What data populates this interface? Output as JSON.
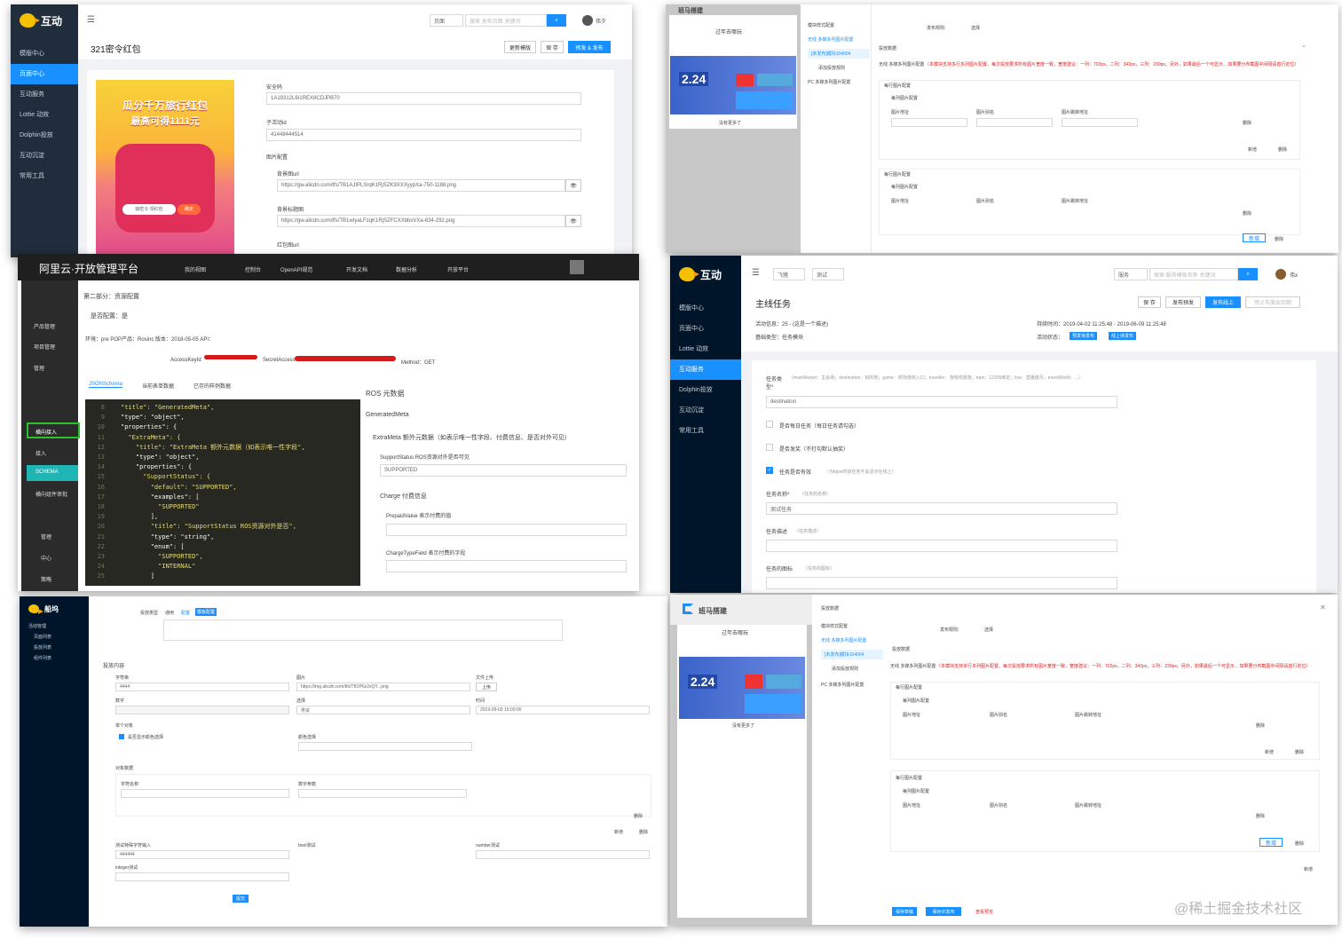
{
  "colors": {
    "primary": "#1890ff",
    "sidebar": "#1f2d3d",
    "aliyun_bar": "#1f1f1f",
    "code_bg": "#272822",
    "highlight_green": "#2ac12a"
  },
  "p1": {
    "brand": "互动",
    "nav": [
      "模版中心",
      "页面中心",
      "互动服务",
      "Lottie 动效",
      "Dolphin投放",
      "互动沉淀",
      "常用工具"
    ],
    "search_select": "页面",
    "search_placeholder": "搜索 发布页面 关键词",
    "user": "伟夕",
    "title": "321密令红包",
    "btn_update": "更新模版",
    "btn_save": "保 存",
    "btn_publish": "预发 & 发布",
    "poster": {
      "top": "瓜分千万旅行红包",
      "mid": "最高可得1111元",
      "sub": "输密令 领红包",
      "sub2": "确定"
    },
    "f_key_label": "安全码",
    "f_key_value": "1A19312L6I1REX8CDJPB70",
    "f_id_label": "子活动id",
    "f_id_value": "41448444514",
    "f_img_label": "图片配置",
    "f_bg_label": "背景图url",
    "f_bg_value": "https://gw.alicdn.com/tfs/TB1AJIPLSrqK1RjSZK9XXXyypXa-750-1188.png",
    "f_title_label": "背景标题图",
    "f_title_value": "https://gw.alicdn.com/tfs/TB1wIyaLFzqK1RjSZFCXXbbvVXa-634-292.png",
    "f_packet_label": "红包图url"
  },
  "p2": {
    "title": "班马搭建",
    "banner": "过年去哪玩",
    "more": "没有更多了",
    "date": "2.24",
    "tree": [
      "模块样式配置",
      "无线 多媒多列图片配置",
      "[未发布]模块104004",
      "添加投放规则",
      "PC 多媒多列图片配置"
    ],
    "rules_label": "发布规则:",
    "rules_val": "选择",
    "put": "投放数据",
    "wireless": "无线 多媒多列图片配置",
    "note": "（本模块支持多行多列图片配置。每次投放要求所有图片宽度一致，宽度建议：一列：702px，二列：342px，三列：230px。另外，如果最后一个可显示... 如果要分布截图中间隔请首行定位）",
    "row_cfg": "每行图片配置",
    "col_cfg": "每列图片配置",
    "c1": "图片地址",
    "c2": "图片别名",
    "c3": "图片跳转地址",
    "del": "删除",
    "add": "新增"
  },
  "p3": {
    "brand": "阿里云·开放管理平台",
    "top_nav": [
      "我的视图",
      "控制台",
      "OpenAPI规范",
      "开发文档",
      "数据分析",
      "开放平台"
    ],
    "section": "第二部分：资源配置",
    "sub": "是否配置：是",
    "env": "环境：pre  POP产品：Rosinc  版本：2018-05-05  API：",
    "keyid": "AccessKeyId",
    "secret": "SecretAccess",
    "method": "Method：GET",
    "tabs": [
      "JSONSchema",
      "当前表单数据",
      "已存的样例数据"
    ],
    "side": [
      "产品管理",
      "项目管理",
      "管理",
      "",
      "",
      "横向接入",
      "接入",
      "SCHEMA",
      "横向组件审批",
      "",
      "管理",
      "中心",
      "策略"
    ],
    "lines": [
      [
        "8",
        "\"title\": \"GeneratedMeta\","
      ],
      [
        "9",
        "\"type\": \"object\","
      ],
      [
        "10",
        "\"properties\": {"
      ],
      [
        "11",
        "  \"ExtraMeta\": {"
      ],
      [
        "12",
        "    \"title\": \"ExtraMeta 额外元数据（如表示唯一性字段\","
      ],
      [
        "13",
        "    \"type\": \"object\","
      ],
      [
        "14",
        "    \"properties\": {"
      ],
      [
        "15",
        "      \"SupportStatus\": {"
      ],
      [
        "16",
        "        \"default\": \"SUPPORTED\","
      ],
      [
        "17",
        "        \"examples\": ["
      ],
      [
        "18",
        "          \"SUPPORTED\""
      ],
      [
        "19",
        "        ],"
      ],
      [
        "20",
        "        \"title\": \"SupportStatus ROS资源对外是否\","
      ],
      [
        "21",
        "        \"type\": \"string\","
      ],
      [
        "22",
        "        \"enum\": ["
      ],
      [
        "23",
        "          \"SUPPORTED\","
      ],
      [
        "24",
        "          \"INTERNAL\""
      ],
      [
        "25",
        "        ]"
      ]
    ],
    "ros": "ROS 元数据",
    "gen": "GeneratedMeta",
    "extra": "ExtraMeta 额外元数据（如表示唯一性字段、付费信息、是否对外可见）",
    "support_label": "SupportStatus ROS资源对外是否可见",
    "support_val": "SUPPORTED",
    "charge": "Charge 付费信息",
    "prepaid": "PrepaidValue 表示付费的值",
    "chargetype": "ChargeTypeField 表示付费的字段"
  },
  "p4": {
    "brand": "互动",
    "nav": [
      "模版中心",
      "页面中心",
      "Lottie 动效",
      "互动服务",
      "Dolphin投放",
      "互动沉淀",
      "常用工具"
    ],
    "sel1": "飞猪",
    "sel2": "测试",
    "sel3": "服务",
    "search_placeholder": "搜索 服务模板名称 关键词",
    "user": "伟x",
    "title": "主线任务",
    "b_save": "保 存",
    "b_pre": "发布预发",
    "b_online": "发布线上",
    "b_stop": "停止灰度出到期",
    "info1": "活动信息：25 - (这是一个描述)",
    "info2": "基础类型：任务模块",
    "time": "持续时间：2019-04-02 11:25:48 - 2019-06-09 11:25:48",
    "status_label": "活动状态：",
    "tag1": "预发待发布",
    "tag2": "线上待发布",
    "task_type": "任务类型*",
    "task_hint": "（mainMarket：主会场；destination：目的地；game：商场游戏入口；traveller：游戏线旅游；train：12306绑定；live：直播首页；travelWorld：...）",
    "task_val": "destination",
    "c1": "是否每日任务（每日任务请勾选）",
    "c2": "是否发奖（不打勾默认抽奖）",
    "c3": "任务是否有效",
    "c3_hint": "（为false时该任务不会显示在线上）",
    "name_label": "任务名称*",
    "name_hint": "（任务的名称）",
    "name_val": "测试任务",
    "desc_label": "任务描述",
    "desc_hint": "（任务描述）",
    "icon_label": "任务的图标",
    "icon_hint": "（任务的图标）"
  },
  "p5": {
    "brand": "船坞",
    "nav": [
      "活动管理",
      "页面列表",
      "投放列表",
      "组件列表"
    ],
    "r1": "投放类型",
    "r1_opts": [
      "通用",
      "配置"
    ],
    "r1_btn": "模板配置",
    "content": "投放内容",
    "f_str": "字符串",
    "f_str_val": "4444",
    "f_img": "图片",
    "f_img_val": "https://img.alicdn.com/tfs/TB1P6z2xQY...png",
    "f_upload": "上传",
    "f_file": "文件上传",
    "f_num": "数字",
    "f_sel": "选择",
    "f_sel_val": "男说",
    "f_time": "时间",
    "f_time_val": "2019-09-03 15:00:00",
    "f_bool": "单个对象",
    "f_chk": "是否显示颜色选择",
    "f_color": "颜色选择",
    "f_obj": "对象数据",
    "f_a": "字符名称",
    "f_b": "数字参数",
    "f_add": "新增",
    "f_del": "删除",
    "f_multi": "测试特殊字符输入",
    "f_multi_val": "444444",
    "f_bool2": "bool测试",
    "f_num2": "number测试",
    "f_int": "integer测试",
    "submit": "提交"
  },
  "p6": {
    "title": "班马搭建",
    "save": "保存草稿",
    "save_pub": "保存并发布",
    "pre": "查看预览",
    "watermark": "@稀土掘金技术社区"
  }
}
